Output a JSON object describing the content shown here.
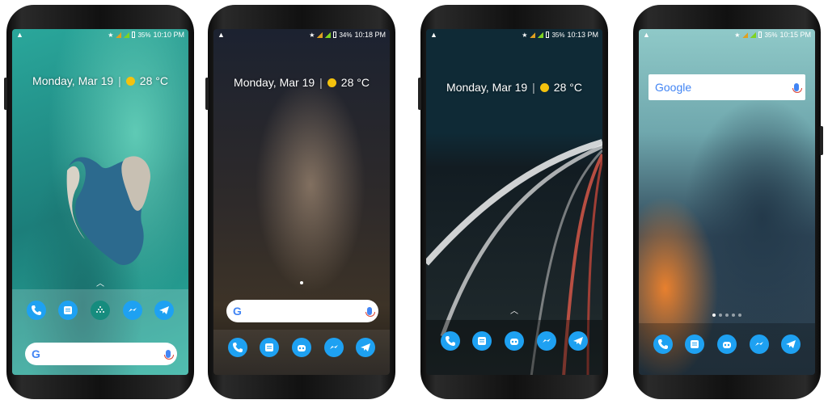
{
  "phones": [
    {
      "date": "Monday, Mar 19",
      "temp": "28 °C",
      "battery": "35%",
      "time": "10:10 PM"
    },
    {
      "date": "Monday, Mar 19",
      "temp": "28 °C",
      "battery": "34%",
      "time": "10:18 PM"
    },
    {
      "date": "Monday, Mar 19",
      "temp": "28 °C",
      "battery": "35%",
      "time": "10:13 PM"
    },
    {
      "battery": "35%",
      "time": "10:15 PM",
      "google": "Google"
    }
  ],
  "dock_icons": [
    "phone-icon",
    "messages-icon",
    "app-drawer-icon",
    "messenger-icon",
    "telegram-icon"
  ],
  "colors": {
    "accent": "#1ea1f2",
    "sun": "#f4c20d"
  }
}
